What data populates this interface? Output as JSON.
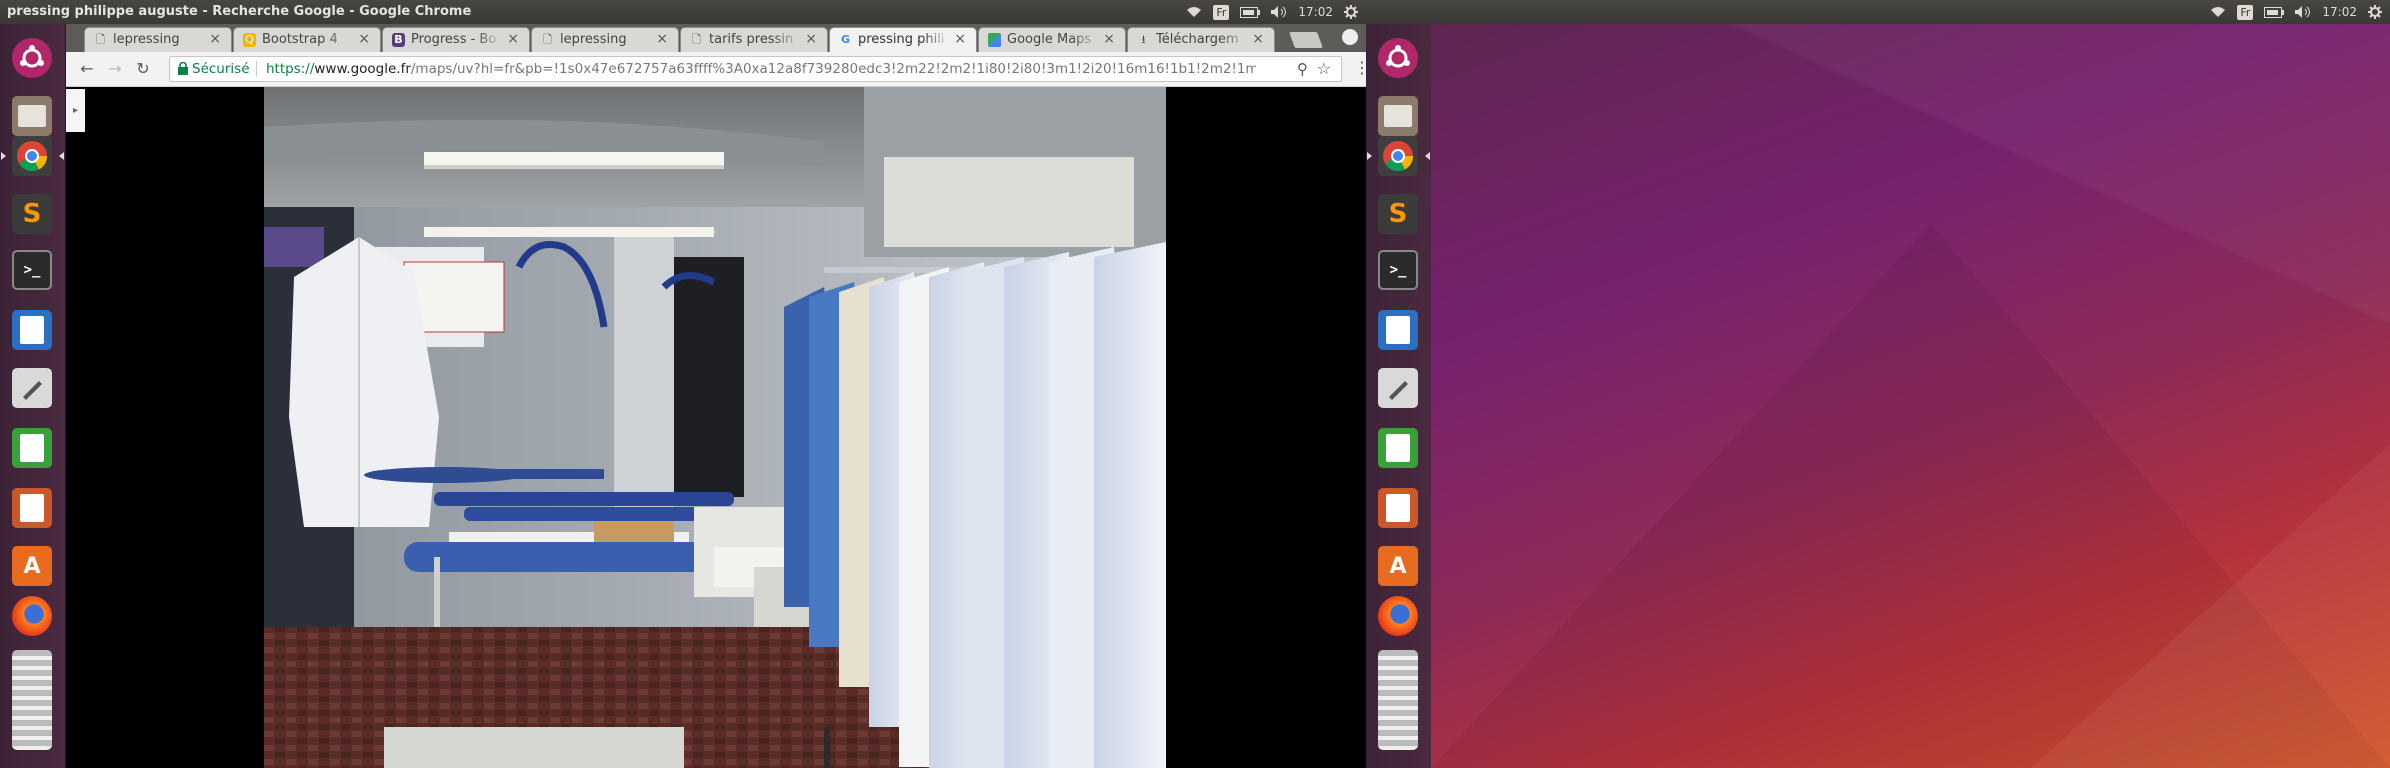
{
  "window_title": "pressing philippe auguste - Recherche Google - Google Chrome",
  "tray": {
    "lang": "Fr",
    "time": "17:02"
  },
  "tray2": {
    "lang": "Fr",
    "time": "17:02"
  },
  "tabs": [
    {
      "label": "lepressing",
      "favicon": "page-icon"
    },
    {
      "label": "Bootstrap 4",
      "favicon": "bootstrap-favicon"
    },
    {
      "label": "Progress - Bo",
      "favicon": "bootstrap-b-favicon"
    },
    {
      "label": "lepressing",
      "favicon": "page-icon"
    },
    {
      "label": "tarifs pressin",
      "favicon": "page-icon"
    },
    {
      "label": "pressing phili",
      "favicon": "google-favicon",
      "active": true
    },
    {
      "label": "Google Maps",
      "favicon": "maps-favicon"
    },
    {
      "label": "Téléchargem",
      "favicon": "download-icon"
    }
  ],
  "address_bar": {
    "secure_label": "Sécurisé",
    "url_proto": "https://",
    "url_host": "www.google.fr",
    "url_rest": "/maps/uv?hl=fr&pb=!1s0x47e672757a63ffff%3A0xa12a8f739280edc3!2m22!2m2!1i80!2i80!3m1!2i20!16m16!1b1!2m2!1m1!1e1!2m2!1..."
  },
  "launcher_apps": [
    "ubuntu-dash-icon",
    "files-icon",
    "chrome-icon",
    "sublime-text-icon",
    "terminal-icon",
    "libreoffice-writer-icon",
    "text-editor-icon",
    "libreoffice-calc-icon",
    "libreoffice-impress-icon",
    "software-center-icon",
    "firefox-icon",
    "trash-icon"
  ],
  "colors": {
    "launcher_bg": "#4a2a40",
    "secure_green": "#0b8043",
    "wallpaper_purple": "#77216f",
    "wallpaper_orange": "#d2572a"
  }
}
